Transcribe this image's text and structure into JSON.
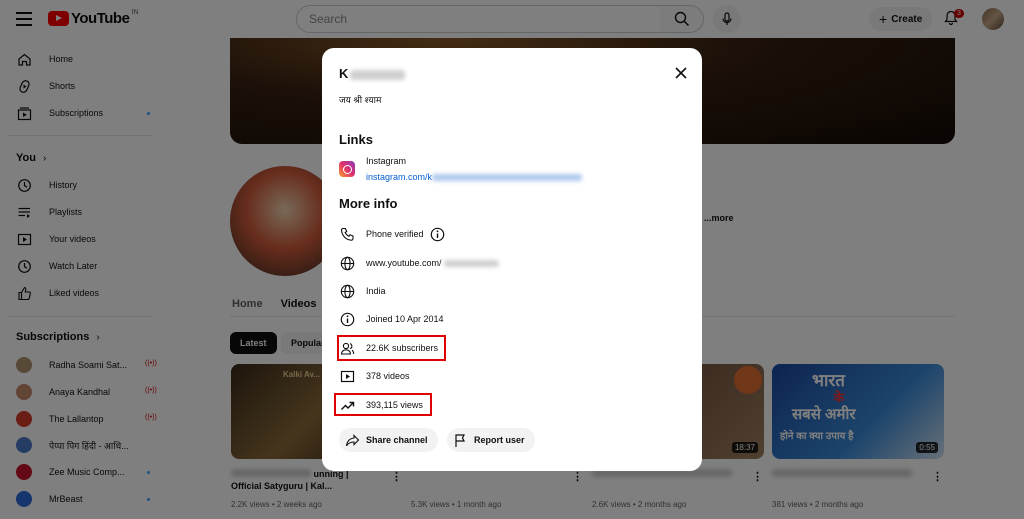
{
  "header": {
    "logo_text": "YouTube",
    "country_code": "IN",
    "search_placeholder": "Search",
    "create_label": "Create",
    "notification_count": "3"
  },
  "sidebar": {
    "main_items": [
      {
        "label": "Home",
        "icon": "home-icon"
      },
      {
        "label": "Shorts",
        "icon": "shorts-icon"
      },
      {
        "label": "Subscriptions",
        "icon": "subscriptions-icon"
      }
    ],
    "you_heading": "You",
    "you_items": [
      {
        "label": "History",
        "icon": "history-icon"
      },
      {
        "label": "Playlists",
        "icon": "playlists-icon"
      },
      {
        "label": "Your videos",
        "icon": "your-videos-icon"
      },
      {
        "label": "Watch Later",
        "icon": "watch-later-icon"
      },
      {
        "label": "Liked videos",
        "icon": "liked-icon"
      }
    ],
    "subscriptions_heading": "Subscriptions",
    "subscriptions": [
      {
        "label": "Radha Soami Sat...",
        "status": "live"
      },
      {
        "label": "Anaya Kandhal",
        "status": "live"
      },
      {
        "label": "The Lallantop",
        "status": "live"
      },
      {
        "label": "पेप्पा पिग हिंदी - आधि...",
        "status": "none"
      },
      {
        "label": "Zee Music Comp...",
        "status": "dot"
      },
      {
        "label": "MrBeast",
        "status": "dot"
      }
    ]
  },
  "channel_page": {
    "more_link": "...more",
    "tabs": [
      "Home",
      "Videos"
    ],
    "chips": [
      "Latest",
      "Popular"
    ],
    "videos": [
      {
        "title_visible": "unning | Official Satyguru | Kal...",
        "meta": "2.2K views • 2 weeks ago",
        "duration": ""
      },
      {
        "title_visible": "",
        "meta": "5.3K views • 1 month ago",
        "duration": ""
      },
      {
        "title_visible": "",
        "meta": "2.6K views • 2 months ago",
        "duration": "18:37"
      },
      {
        "title_visible": "",
        "meta": "381 views • 2 months ago",
        "duration": "0:55"
      }
    ],
    "thumb4_text_line1": "भारत",
    "thumb4_text_line2": "के",
    "thumb4_text_line3": "सबसे अमीर",
    "thumb4_text_line4": "होने का क्या उपाय है",
    "thumb1_text": "Kalki Av..."
  },
  "modal": {
    "name_initial": "K",
    "description": "जय श्री श्याम",
    "links_heading": "Links",
    "link": {
      "title": "Instagram",
      "url_visible": "instagram.com/k"
    },
    "more_info_heading": "More info",
    "phone_verified": "Phone verified",
    "website_visible": "www.youtube.com/",
    "country": "India",
    "joined": "Joined 10 Apr 2014",
    "subscribers": "22.6K subscribers",
    "videos": "378 videos",
    "views": "393,115 views",
    "share_label": "Share channel",
    "report_label": "Report user",
    "highlight_color": "#e00000"
  }
}
